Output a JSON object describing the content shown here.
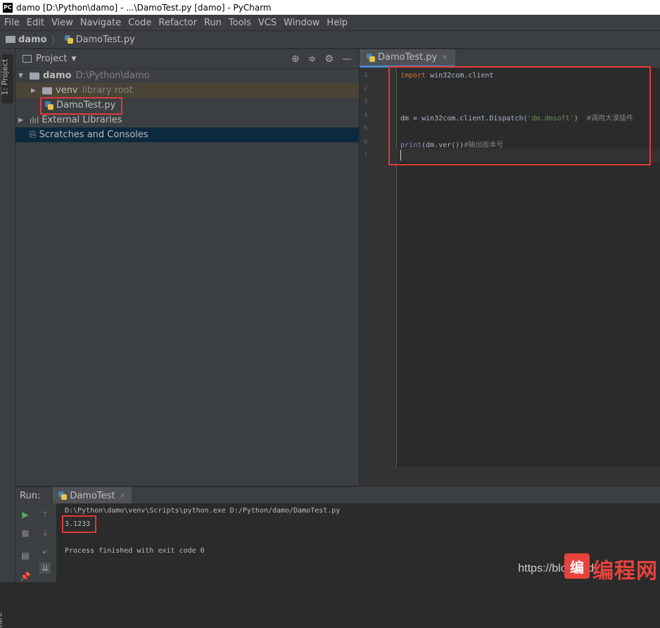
{
  "window": {
    "title": "damo [D:\\Python\\damo] - ...\\DamoTest.py [damo] - PyCharm"
  },
  "menu": [
    "File",
    "Edit",
    "View",
    "Navigate",
    "Code",
    "Refactor",
    "Run",
    "Tools",
    "VCS",
    "Window",
    "Help"
  ],
  "breadcrumb": {
    "project": "damo",
    "file": "DamoTest.py"
  },
  "left_strip": {
    "project_tab": "1: Project",
    "structure_tab": "ture"
  },
  "project_panel": {
    "title": "Project",
    "tree": [
      {
        "label": "damo",
        "hint": "D:\\Python\\damo"
      },
      {
        "label": "venv",
        "hint": "library root"
      },
      {
        "label": "DamoTest.py"
      },
      {
        "label": "External Libraries"
      },
      {
        "label": "Scratches and Consoles"
      }
    ]
  },
  "editor": {
    "tab": "DamoTest.py",
    "line_numbers": [
      "1",
      "2",
      "3",
      "4",
      "5",
      "6",
      "7"
    ],
    "code": {
      "l1_kw": "import",
      "l1_rest": " win32com.client",
      "l4_a": "dm = win32com.client.Dispatch(",
      "l4_str": "'dm.dmsoft'",
      "l4_b": ")  ",
      "l4_cmt": "#调用大漠插件",
      "l6_fn": "print",
      "l6_rest": "(dm.ver())",
      "l6_cmt": "#输出版本号"
    }
  },
  "run_panel": {
    "label": "Run:",
    "tab": "DamoTest",
    "console": [
      "D:\\Python\\damo\\venv\\Scripts\\python.exe D:/Python/damo/DamoTest.py",
      "3.1233",
      "",
      "Process finished with exit code 0"
    ]
  },
  "watermark": {
    "url": "https://blog.csd",
    "logo_letter": "编",
    "logo_text": "编程网"
  },
  "colors": {
    "highlight_box": "#e03a3a",
    "accent": "#4a88c7"
  }
}
